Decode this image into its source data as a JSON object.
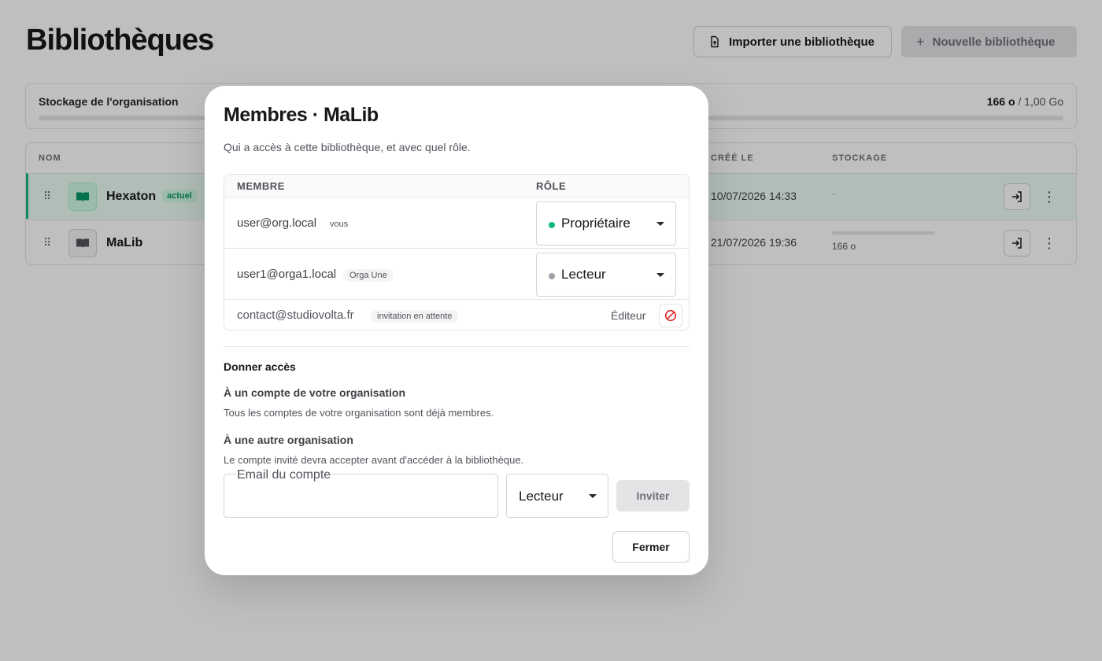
{
  "page": {
    "title": "Bibliothèques",
    "import_label": "Importer une bibliothèque",
    "new_label": "Nouvelle bibliothèque"
  },
  "storage": {
    "label": "Stockage de l'organisation",
    "used": "166 o",
    "total": "/ 1,00 Go",
    "fraction_used": 0
  },
  "table": {
    "headers": {
      "name": "NOM",
      "created": "CRÉÉ LE",
      "storage": "STOCKAGE"
    },
    "rows": [
      {
        "name": "Hexaton",
        "badge": "actuel",
        "created": "10/07/2026 14:33",
        "storage": "·",
        "current": true
      },
      {
        "name": "MaLib",
        "badge": "",
        "created": "21/07/2026 19:36",
        "storage": "166 o",
        "current": false
      }
    ]
  },
  "modal": {
    "title": "Membres · MaLib",
    "subtitle": "Qui a accès à cette bibliothèque, et avec quel rôle.",
    "col_member": "MEMBRE",
    "col_role": "RÔLE",
    "members": [
      {
        "email": "user@org.local",
        "tag": "vous",
        "role": "Propriétaire",
        "dot_color": "#10b981"
      },
      {
        "email": "user1@orga1.local",
        "tag": "Orga Une",
        "role": "Lecteur",
        "dot_color": "#a1a1aa"
      },
      {
        "email": "contact@studiovolta.fr",
        "tag": "invitation en attente",
        "role": "Éditeur"
      }
    ],
    "give_access_title": "Donner accès",
    "own_org_title": "À un compte de votre organisation",
    "own_org_hint": "Tous les comptes de votre organisation sont déjà membres.",
    "other_org_title": "À une autre organisation",
    "other_org_hint": "Le compte invité devra accepter avant d'accéder à la bibliothèque.",
    "email_label": "Email du compte",
    "email_value": "",
    "invite_role": "Lecteur",
    "invite_label": "Inviter",
    "close_label": "Fermer"
  },
  "colors": {
    "accent": "#10b981",
    "danger": "#dc2626",
    "overlay": "rgba(0,0,0,0.25)"
  }
}
